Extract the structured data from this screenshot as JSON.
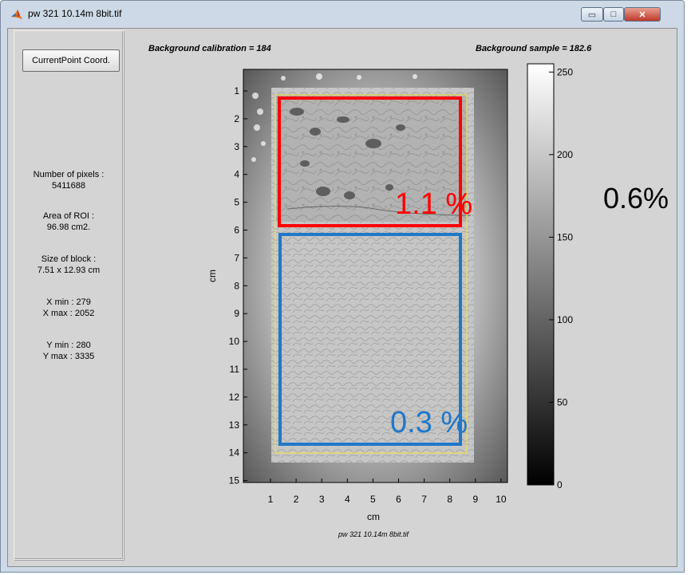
{
  "window": {
    "title": "pw 321 10.14m 8bit.tif",
    "minimize_glyph": "▭",
    "maximize_glyph": "□",
    "close_glyph": "✕"
  },
  "left_panel": {
    "button_label": "CurrentPoint Coord.",
    "num_pixels_label": "Number of pixels :",
    "num_pixels_value": "5411688",
    "area_label": "Area of ROI :",
    "area_value": "96.98 cm2.",
    "size_label": "Size of block :",
    "size_value": "7.51 x 12.93 cm",
    "xmin": "X min : 279",
    "xmax": "X max : 2052",
    "ymin": "Y min : 280",
    "ymax": "Y max : 3335"
  },
  "header": {
    "calibration": "Background calibration = 184",
    "sample": "Background sample = 182.6"
  },
  "plot": {
    "y_ticks": [
      "1",
      "2",
      "3",
      "4",
      "5",
      "6",
      "7",
      "8",
      "9",
      "10",
      "11",
      "12",
      "13",
      "14",
      "15"
    ],
    "x_ticks": [
      "1",
      "2",
      "3",
      "4",
      "5",
      "6",
      "7",
      "8",
      "9",
      "10"
    ],
    "y_label": "cm",
    "x_label": "cm",
    "caption": "pw 321 10.14m 8bit.tif"
  },
  "colorbar": {
    "ticks": [
      "250",
      "200",
      "150",
      "100",
      "50",
      "0"
    ],
    "min": 0,
    "max": 255
  },
  "annotations": {
    "top_roi_pct": "1.1 %",
    "bottom_roi_pct": "0.3 %",
    "overall_pct": "0.6%",
    "top_color": "#ff0000",
    "bottom_color": "#1f78c8"
  }
}
